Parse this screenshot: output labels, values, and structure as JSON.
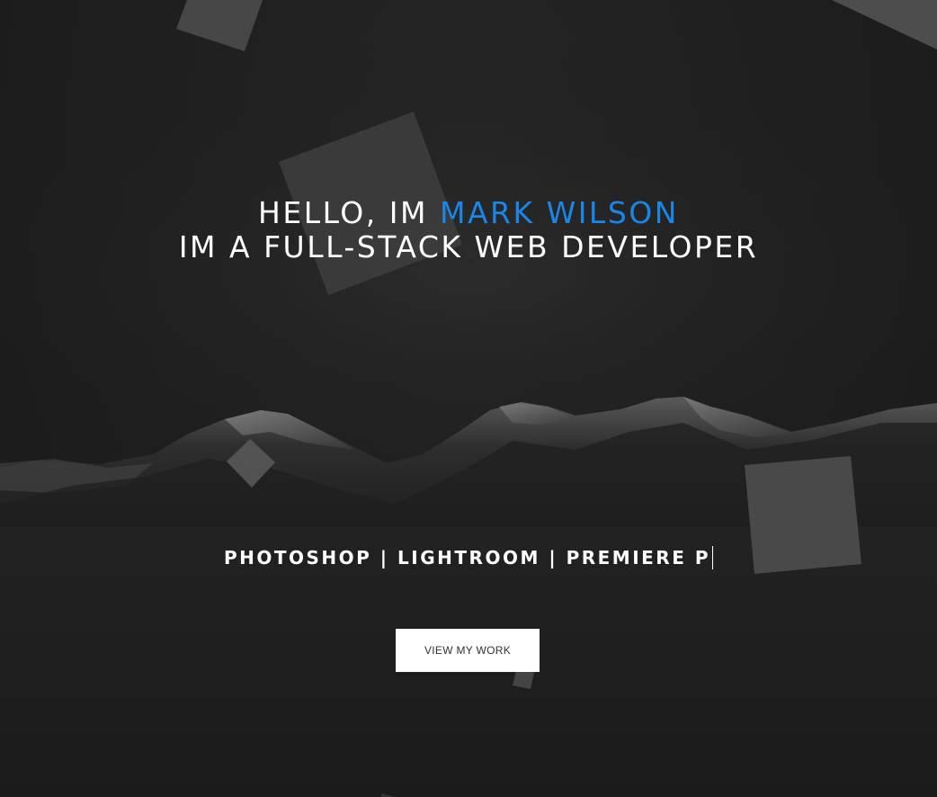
{
  "hero": {
    "greeting_prefix": "HELLO, IM ",
    "name": "MARK WILSON",
    "subtitle": "IM A FULL-STACK WEB DEVELOPER",
    "skills": "PHOTOSHOP | LIGHTROOM | PREMIERE P",
    "cta_label": "VIEW MY WORK"
  },
  "colors": {
    "accent": "#1a86e8",
    "background": "#1e1e1e",
    "button_bg": "#ffffff",
    "button_text": "#333333"
  },
  "icons": {
    "typing_cursor": "text-cursor-icon"
  }
}
